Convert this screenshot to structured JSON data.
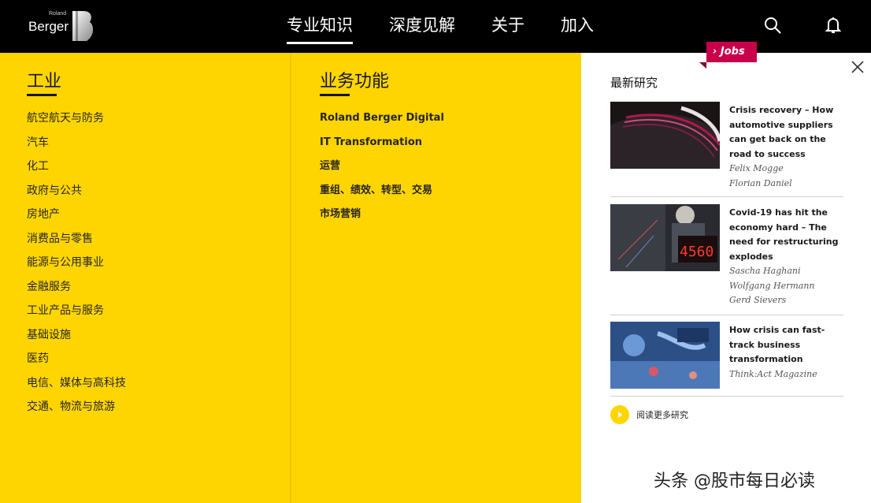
{
  "header": {
    "logo_small": "Roland",
    "logo_text": "Berger",
    "nav": [
      "专业知识",
      "深度见解",
      "关于",
      "加入"
    ]
  },
  "industry": {
    "title": "工业",
    "items": [
      "航空航天与防务",
      "汽车",
      "化工",
      "政府与公共",
      "房地产",
      "消费品与零售",
      "能源与公用事业",
      "金融服务",
      "工业产品与服务",
      "基础设施",
      "医药",
      "电信、媒体与高科技",
      "交通、物流与旅游"
    ]
  },
  "functions": {
    "title": "业务功能",
    "items": [
      "Roland Berger Digital",
      "IT Transformation",
      "运营",
      "重组、绩效、转型、交易",
      "市场营销"
    ]
  },
  "panel": {
    "jobs_label": "› Jobs",
    "title": "最新研究",
    "articles": [
      {
        "title": "Crisis recovery – How automotive suppliers can get back on the road to success",
        "authors": [
          "Felix Mogge",
          "Florian Daniel"
        ]
      },
      {
        "title": "Covid-19 has hit the economy hard – The need for restructuring explodes",
        "authors": [
          "Sascha Haghani",
          "Wolfgang Hermann",
          "Gerd Sievers"
        ]
      },
      {
        "title": "How crisis can fast-track business transformation",
        "authors": [
          "Think:Act Magazine"
        ]
      }
    ],
    "more_label": "阅读更多研究"
  },
  "watermark": "头条 @股市每日必读",
  "colors": {
    "accent_yellow": "#ffd500",
    "jobs_magenta": "#c8004b",
    "header_black": "#000000"
  }
}
